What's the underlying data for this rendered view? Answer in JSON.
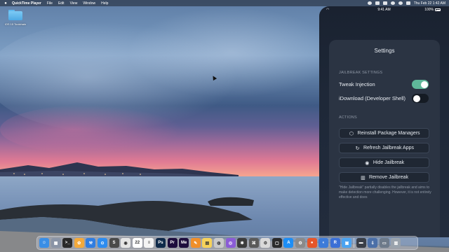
{
  "menubar": {
    "apple_icon": "apple-icon",
    "items": [
      "QuickTime Player",
      "File",
      "Edit",
      "View",
      "Window",
      "Help"
    ],
    "clock": "Thu Feb 22  1:42 AM"
  },
  "desktop": {
    "folder_label": "iOS 15 Toolchain"
  },
  "phone": {
    "status_time": "9:41 AM",
    "battery": "100%",
    "settings_title": "Settings",
    "jailbreak_section": "JAILBREAK SETTINGS",
    "toggles": [
      {
        "label": "Tweak Injection",
        "state": "on"
      },
      {
        "label": "iDownload (Developer Shell)",
        "state": "off"
      }
    ],
    "actions_section": "ACTIONS",
    "actions": [
      {
        "label": "Reinstall Package Managers",
        "icon": "package-icon"
      },
      {
        "label": "Refresh Jailbreak Apps",
        "icon": "refresh-icon"
      },
      {
        "label": "Hide Jailbreak",
        "icon": "eye-icon"
      },
      {
        "label": "Remove Jailbreak",
        "icon": "trash-icon"
      }
    ],
    "footnote": "\"Hide Jailbreak\" partially disables the jailbreak and aims to make detection more challenging. However, it is not entirely effective and does"
  },
  "dock": {
    "icons": [
      {
        "name": "finder-icon",
        "color": "#3a8ee6",
        "glyph": "☺"
      },
      {
        "name": "launchpad-icon",
        "color": "#8a94a6",
        "glyph": "▦"
      },
      {
        "name": "terminal-icon",
        "color": "#2a2a2a",
        "glyph": ">_"
      },
      {
        "name": "photos-icon",
        "color": "#f2a93b",
        "glyph": "✿"
      },
      {
        "name": "xcode-icon",
        "color": "#2f7de1",
        "glyph": "⚒"
      },
      {
        "name": "safari-icon",
        "color": "#2d8cf0",
        "glyph": "⊙"
      },
      {
        "name": "sublime-icon",
        "color": "#4a4a4a",
        "glyph": "S"
      },
      {
        "name": "chrome-icon",
        "color": "#e5e5e5",
        "glyph": "◉"
      },
      {
        "name": "calendar-icon",
        "color": "#ffffff",
        "glyph": "22"
      },
      {
        "name": "reminders-icon",
        "color": "#f4f4f4",
        "glyph": "≡"
      },
      {
        "name": "photoshop-icon",
        "color": "#0f2a4a",
        "glyph": "Ps"
      },
      {
        "name": "premiere-icon",
        "color": "#1d0d3d",
        "glyph": "Pr"
      },
      {
        "name": "media-encoder-icon",
        "color": "#1d0d3d",
        "glyph": "Me"
      },
      {
        "name": "pages-icon",
        "color": "#f08f2a",
        "glyph": "✎"
      },
      {
        "name": "notes-icon",
        "color": "#f6d25a",
        "glyph": "▤"
      },
      {
        "name": "utility-icon",
        "color": "#c9c9c9",
        "glyph": "◍"
      },
      {
        "name": "github-icon",
        "color": "#8b5cd6",
        "glyph": "◎"
      },
      {
        "name": "activity-icon",
        "color": "#3c3c3c",
        "glyph": "✱"
      },
      {
        "name": "scripts-icon",
        "color": "#5a5a5a",
        "glyph": "⌘"
      },
      {
        "name": "tool-icon",
        "color": "#d9d9d9",
        "glyph": "⚙"
      },
      {
        "name": "window-icon",
        "color": "#2b2b2b",
        "glyph": "▢"
      },
      {
        "name": "app-store-icon",
        "color": "#1d8ef5",
        "glyph": "A"
      },
      {
        "name": "system-settings-icon",
        "color": "#8a8a8a",
        "glyph": "⚙"
      },
      {
        "name": "firefox-icon",
        "color": "#e5562a",
        "glyph": "●"
      },
      {
        "name": "browser-icon",
        "color": "#3d7bd9",
        "glyph": "◐"
      },
      {
        "name": "reality-icon",
        "color": "#3b6fd6",
        "glyph": "R"
      },
      {
        "name": "preview-icon",
        "color": "#4ba3f0",
        "glyph": "▣"
      },
      {
        "name": "separator",
        "color": "",
        "glyph": ""
      },
      {
        "name": "screen-icon",
        "color": "#3a3f48",
        "glyph": "▬"
      },
      {
        "name": "downloads-icon",
        "color": "#4b6fa8",
        "glyph": "⇩"
      },
      {
        "name": "folder-icon",
        "color": "#6d7a8a",
        "glyph": "▭"
      },
      {
        "name": "trash-icon",
        "color": "#9aa3ad",
        "glyph": "▥"
      }
    ]
  }
}
